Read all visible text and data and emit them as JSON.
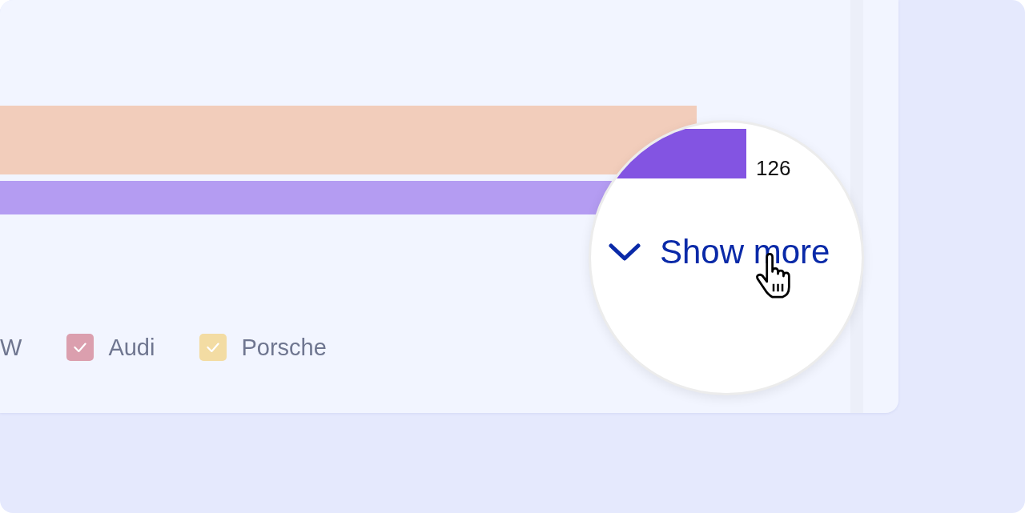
{
  "chart": {
    "bars": [
      {
        "color": "#f2cdbb"
      },
      {
        "color": "#b49cf2"
      }
    ]
  },
  "legend": [
    {
      "label": "W"
    },
    {
      "label": "Audi",
      "checked": true,
      "color": "#db9fae"
    },
    {
      "label": "Porsche",
      "checked": true,
      "color": "#f3dca3"
    }
  ],
  "magnifier": {
    "bar": {
      "color": "#8354e2"
    },
    "value": "126",
    "show_more": {
      "label": "Show more"
    }
  }
}
